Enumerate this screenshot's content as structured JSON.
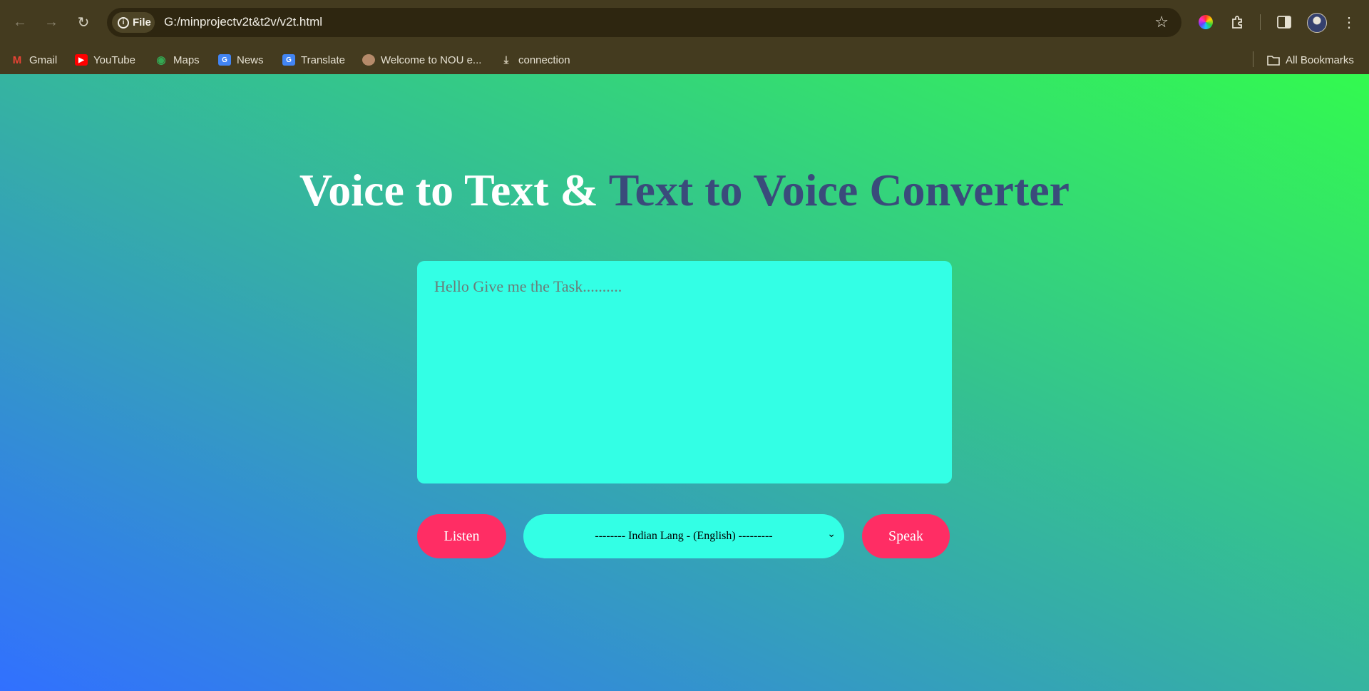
{
  "browser": {
    "url": "G:/minprojectv2t&t2v/v2t.html",
    "scheme_chip": "File",
    "bookmarks": [
      {
        "label": "Gmail",
        "icon": "gmail-icon",
        "color": "#ea4335"
      },
      {
        "label": "YouTube",
        "icon": "youtube-icon",
        "color": "#ff0000"
      },
      {
        "label": "Maps",
        "icon": "maps-icon",
        "color": "#34a853"
      },
      {
        "label": "News",
        "icon": "news-icon",
        "color": "#4285f4"
      },
      {
        "label": "Translate",
        "icon": "translate-icon",
        "color": "#4285f4"
      },
      {
        "label": "Welcome to NOU e...",
        "icon": "nou-icon",
        "color": "#b58a6a"
      },
      {
        "label": "connection",
        "icon": "download-icon",
        "color": "#cfc7b1"
      }
    ],
    "all_bookmarks_label": "All Bookmarks"
  },
  "page": {
    "title_part1": "Voice to Text & ",
    "title_part2": "Text to Voice Converter",
    "textarea_placeholder": "Hello Give me the Task..........",
    "listen_label": "Listen",
    "language_selected": "-------- Indian Lang - (English) ---------",
    "speak_label": "Speak",
    "colors": {
      "gradient_start": "#3170ff",
      "gradient_end": "#33fa4f",
      "title_accent": "#3a4b7b",
      "textarea_bg": "#33ffe5",
      "button_bg": "#ff2d64"
    }
  }
}
